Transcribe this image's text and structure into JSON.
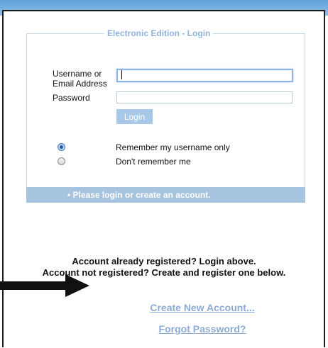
{
  "login_box": {
    "legend": "Electronic Edition - Login",
    "username_label_line1": "Username or",
    "username_label_line2": "Email Address",
    "username_value": "",
    "password_label": "Password",
    "password_value": "",
    "login_button": "Login"
  },
  "remember_options": [
    {
      "label": "Remember my username only",
      "selected": true
    },
    {
      "label": "Don't remember me",
      "selected": false
    }
  ],
  "message_bar": "•  Please login or create an account.",
  "info": {
    "line1": "Account already registered? Login above.",
    "line2": "Account not registered? Create and register one below."
  },
  "links": {
    "create_account": "Create New Account...",
    "forgot_password": "Forgot Password?"
  },
  "icons": {
    "annotation_arrow": "arrow-right-icon"
  },
  "colors": {
    "accent_blue": "#8fb2d9",
    "message_bar": "#a6c3df",
    "link_blue": "#8cabd4"
  }
}
